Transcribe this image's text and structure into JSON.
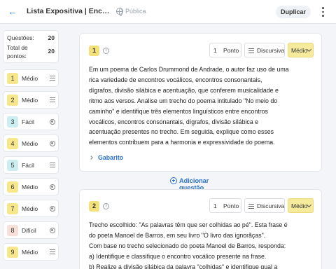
{
  "header": {
    "back_icon": "arrow-left-icon",
    "title": "Lista Expositiva | Encontros vocálicos, encontros consonantais, dígrafos",
    "visibility": "Pública",
    "duplicate_label": "Duplicar",
    "more_icon": "kebab-menu-icon"
  },
  "summary": {
    "questions_label": "Questões:",
    "questions_value": "20",
    "points_label": "Total de pontos:",
    "points_value": "20"
  },
  "colors": {
    "easy": "#cdeef0",
    "medium": "#f6e68c",
    "hard": "#f6e0d9",
    "accent": "#2a72c9"
  },
  "sidebar": {
    "items": [
      {
        "num": "1",
        "difficulty": "Médio",
        "type_icon": "text-lines-icon"
      },
      {
        "num": "2",
        "difficulty": "Médio",
        "type_icon": "text-lines-icon"
      },
      {
        "num": "3",
        "difficulty": "Fácil",
        "type_icon": "radio-icon"
      },
      {
        "num": "4",
        "difficulty": "Médio",
        "type_icon": "radio-icon"
      },
      {
        "num": "5",
        "difficulty": "Fácil",
        "type_icon": "text-lines-icon"
      },
      {
        "num": "6",
        "difficulty": "Médio",
        "type_icon": "radio-icon"
      },
      {
        "num": "7",
        "difficulty": "Médio",
        "type_icon": "radio-icon"
      },
      {
        "num": "8",
        "difficulty": "Difícil",
        "type_icon": "radio-icon"
      },
      {
        "num": "9",
        "difficulty": "Médio",
        "type_icon": "text-lines-icon"
      }
    ]
  },
  "questions": [
    {
      "num": "1",
      "points": "1",
      "points_label": "Ponto",
      "type": "Discursiva",
      "difficulty": "Médio",
      "lines": [
        "Em um poema de Carlos Drummond de Andrade, o autor faz uso de uma",
        "rica variedade de encontros vocálicos, encontros consonantais,",
        "dígrafos, divisão silábica e acentuação, que conferem musicalidade e",
        "ritmo aos versos. Analise um trecho do poema intitulado \"No meio do",
        "caminho\" e identifique três elementos linguísticos entre encontros",
        "vocálicos, encontros consonantais, dígrafos, divisão silábica e",
        "acentuação presentes no trecho. Em seguida, explique como esses",
        "elementos contribuem para a harmonia e expressividade do poema."
      ],
      "answer_label": "Gabarito"
    },
    {
      "num": "2",
      "points": "1",
      "points_label": "Ponto",
      "type": "Discursiva",
      "difficulty": "Médio",
      "lines": [
        "Trecho escolhido: \"As palavras têm que ser colhidas ao pé\". Esta frase é",
        "do poeta Manoel de Barros, em seu livro \"O livro das ignorãças\".",
        "Com base no trecho selecionado do poeta Manoel de Barros, responda:",
        "a) Identifique e classifique o encontro vocálico presente na frase.",
        "b) Realize a divisão silábica da palavra \"colhidas\" e identifique qual a"
      ]
    }
  ],
  "add_question_label": "Adicionar questão"
}
